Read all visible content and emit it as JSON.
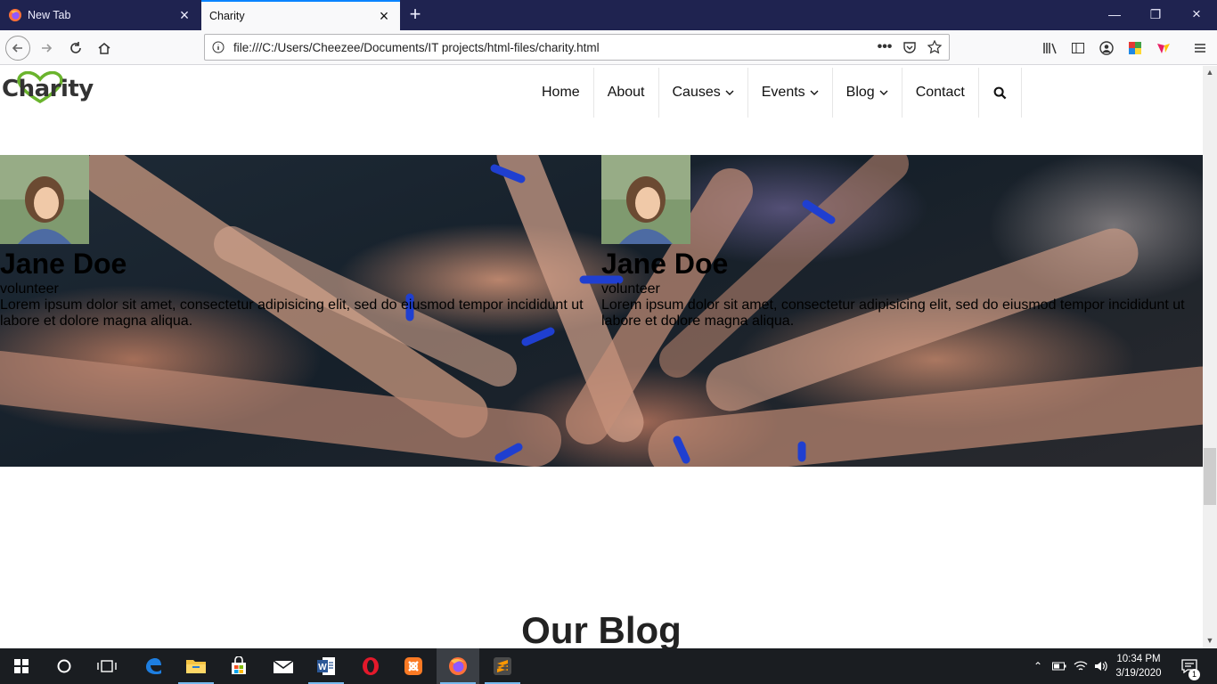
{
  "browser": {
    "tabs": [
      {
        "label": "New Tab",
        "active": false
      },
      {
        "label": "Charity",
        "active": true
      }
    ],
    "url": "file:///C:/Users/Cheezee/Documents/IT projects/html-files/charity.html"
  },
  "site": {
    "logo": "Charity",
    "menu": [
      {
        "label": "Home",
        "dropdown": false
      },
      {
        "label": "About",
        "dropdown": false
      },
      {
        "label": "Causes",
        "dropdown": true
      },
      {
        "label": "Events",
        "dropdown": true
      },
      {
        "label": "Blog",
        "dropdown": true
      },
      {
        "label": "Contact",
        "dropdown": false
      }
    ],
    "volunteers": [
      {
        "name": "Jane Doe",
        "role": "volunteer",
        "bio": "Lorem ipsum dolor sit amet, consectetur adipisicing elit, sed do eiusmod tempor incididunt ut labore et dolore magna aliqua."
      },
      {
        "name": "Jane Doe",
        "role": "volunteer",
        "bio": "Lorem ipsum dolor sit amet, consectetur adipisicing elit, sed do eiusmod tempor incididunt ut labore et dolore magna aliqua."
      }
    ],
    "blog_heading": "Our Blog"
  },
  "taskbar": {
    "time": "10:34 PM",
    "date": "3/19/2020",
    "notification_count": "1"
  },
  "colors": {
    "tab_strip": "#1f2350",
    "accent": "#0a84ff",
    "logo_heart": "#6ab42d",
    "taskbar": "#1a1d21"
  }
}
